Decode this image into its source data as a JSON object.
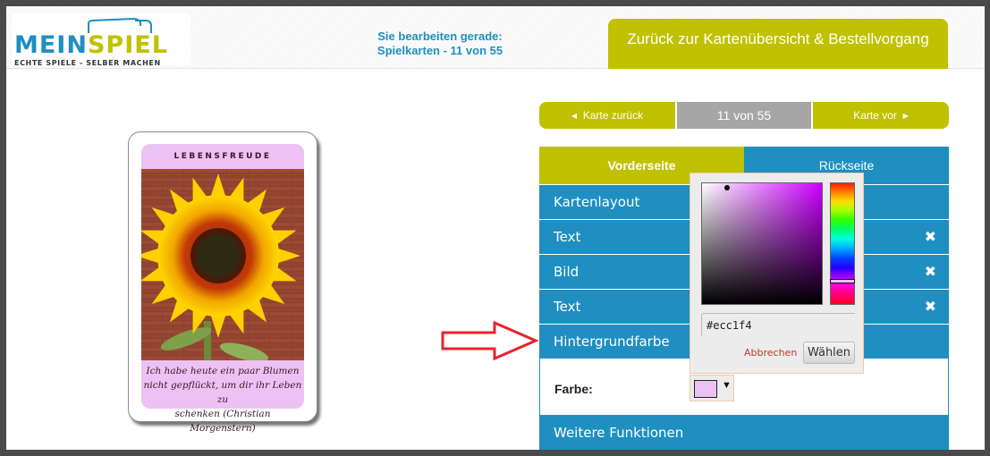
{
  "header": {
    "logo": {
      "word_part1": "MEIN",
      "word_part2": "SPIEL",
      "tagline": "ECHTE SPIELE - SELBER MACHEN"
    },
    "editing_line1": "Sie bearbeiten gerade:",
    "editing_line2": "Spielkarten - 11 von 55",
    "back_button": "Zurück zur Kartenübersicht & Bestellvorgang"
  },
  "card": {
    "title": "LEBENSFREUDE",
    "image": "sunflower-photo",
    "quote_line1": "Ich habe heute ein paar Blumen",
    "quote_line2": "nicht gepflückt, um dir ihr Leben zu",
    "quote_line3": "schenken (Christian Morgenstern)",
    "background_color": "#ecc1f4"
  },
  "pager": {
    "prev_label": "Karte zurück",
    "prev_icon": "triangle-left-icon",
    "count_label": "11 von 55",
    "current": 11,
    "total": 55,
    "next_label": "Karte vor",
    "next_icon": "triangle-right-icon"
  },
  "tabs": [
    {
      "label": "Vorderseite",
      "active": true
    },
    {
      "label": "Rückseite",
      "active": false
    }
  ],
  "sections": [
    {
      "label": "Kartenlayout",
      "removable": false
    },
    {
      "label": "Text",
      "removable": true
    },
    {
      "label": "Bild",
      "removable": true
    },
    {
      "label": "Text",
      "removable": true
    },
    {
      "label": "Hintergrundfarbe",
      "removable": false,
      "expanded": true
    }
  ],
  "remove_icon": "✖",
  "background_section": {
    "farbe_label": "Farbe:",
    "current_color": "#ecc1f4",
    "caret": "▼"
  },
  "more_functions": "Weitere Funktionen",
  "color_picker": {
    "hex_value": "#ecc1f4",
    "cancel_label": "Abbrechen",
    "choose_label": "Wählen"
  },
  "colors": {
    "brand_blue": "#1e8fc0",
    "brand_olive": "#c0c100",
    "pager_gray": "#a6a6a6",
    "annotation_arrow": "#e8232a"
  }
}
